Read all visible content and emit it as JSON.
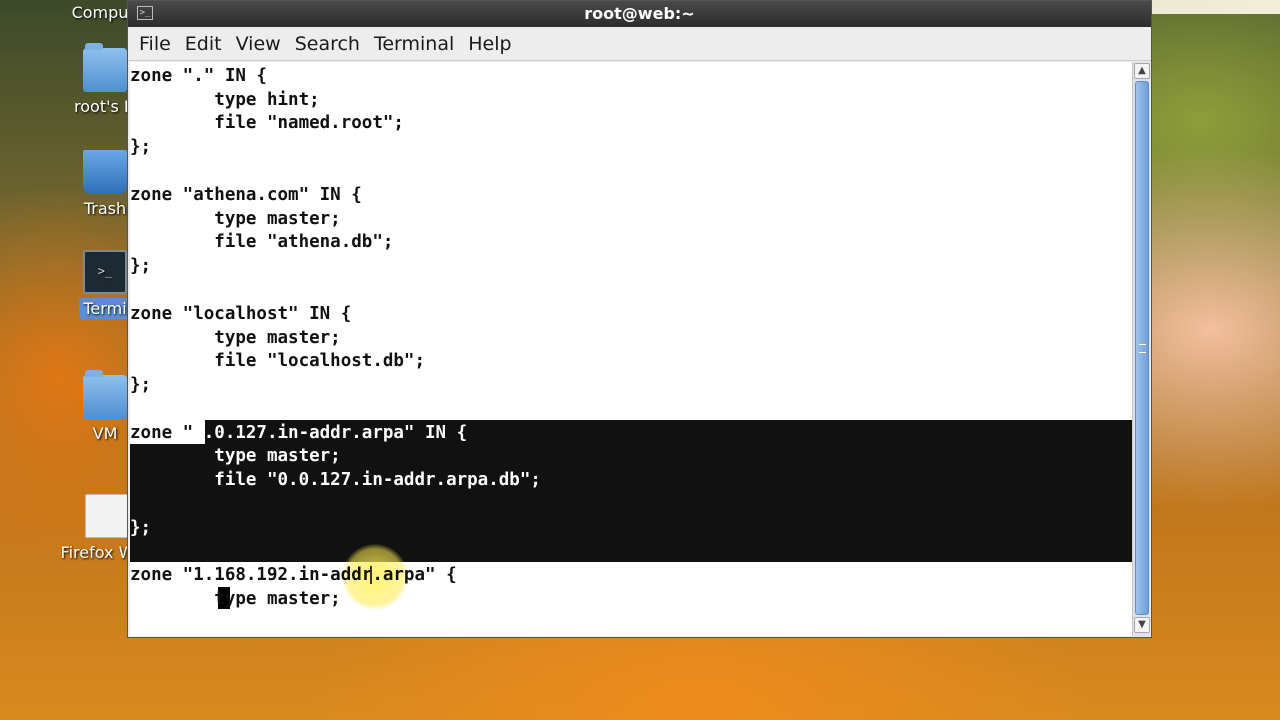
{
  "desktop": {
    "icons": [
      {
        "label": "Compu",
        "icon": "computer-icon"
      },
      {
        "label": "root's H",
        "icon": "home-folder-icon"
      },
      {
        "label": "Trash",
        "icon": "trash-icon"
      },
      {
        "label": "Termi",
        "icon": "terminal-icon"
      },
      {
        "label": "VM",
        "icon": "folder-icon"
      },
      {
        "label": "Firefox Web",
        "icon": "file-icon"
      }
    ]
  },
  "top_panel": {
    "minimize_icon": "minimize-icon",
    "maximize_icon": "maximize-icon",
    "close_icon": "close-icon"
  },
  "window": {
    "title": "root@web:~",
    "menu": [
      "File",
      "Edit",
      "View",
      "Search",
      "Terminal",
      "Help"
    ],
    "terminal_lines": [
      "zone \".\" IN {",
      "        type hint;",
      "        file \"named.root\";",
      "};",
      "",
      "zone \"athena.com\" IN {",
      "        type master;",
      "        file \"athena.db\";",
      "};",
      "",
      "zone \"localhost\" IN {",
      "        type master;",
      "        file \"localhost.db\";",
      "};",
      "",
      "zone \"0.0.127.in-addr.arpa\" IN {",
      "        type master;",
      "        file \"0.0.127.in-addr.arpa.db\";",
      "",
      "};",
      "",
      "zone \"1.168.192.in-addr.arpa\" {",
      "        type master;"
    ],
    "selection_prefix": "zone \"",
    "selection_rest": "0.0.127.in-addr.arpa\" IN {",
    "scrollbar": {
      "up_icon": "scroll-up-icon",
      "down_icon": "scroll-down-icon"
    }
  }
}
